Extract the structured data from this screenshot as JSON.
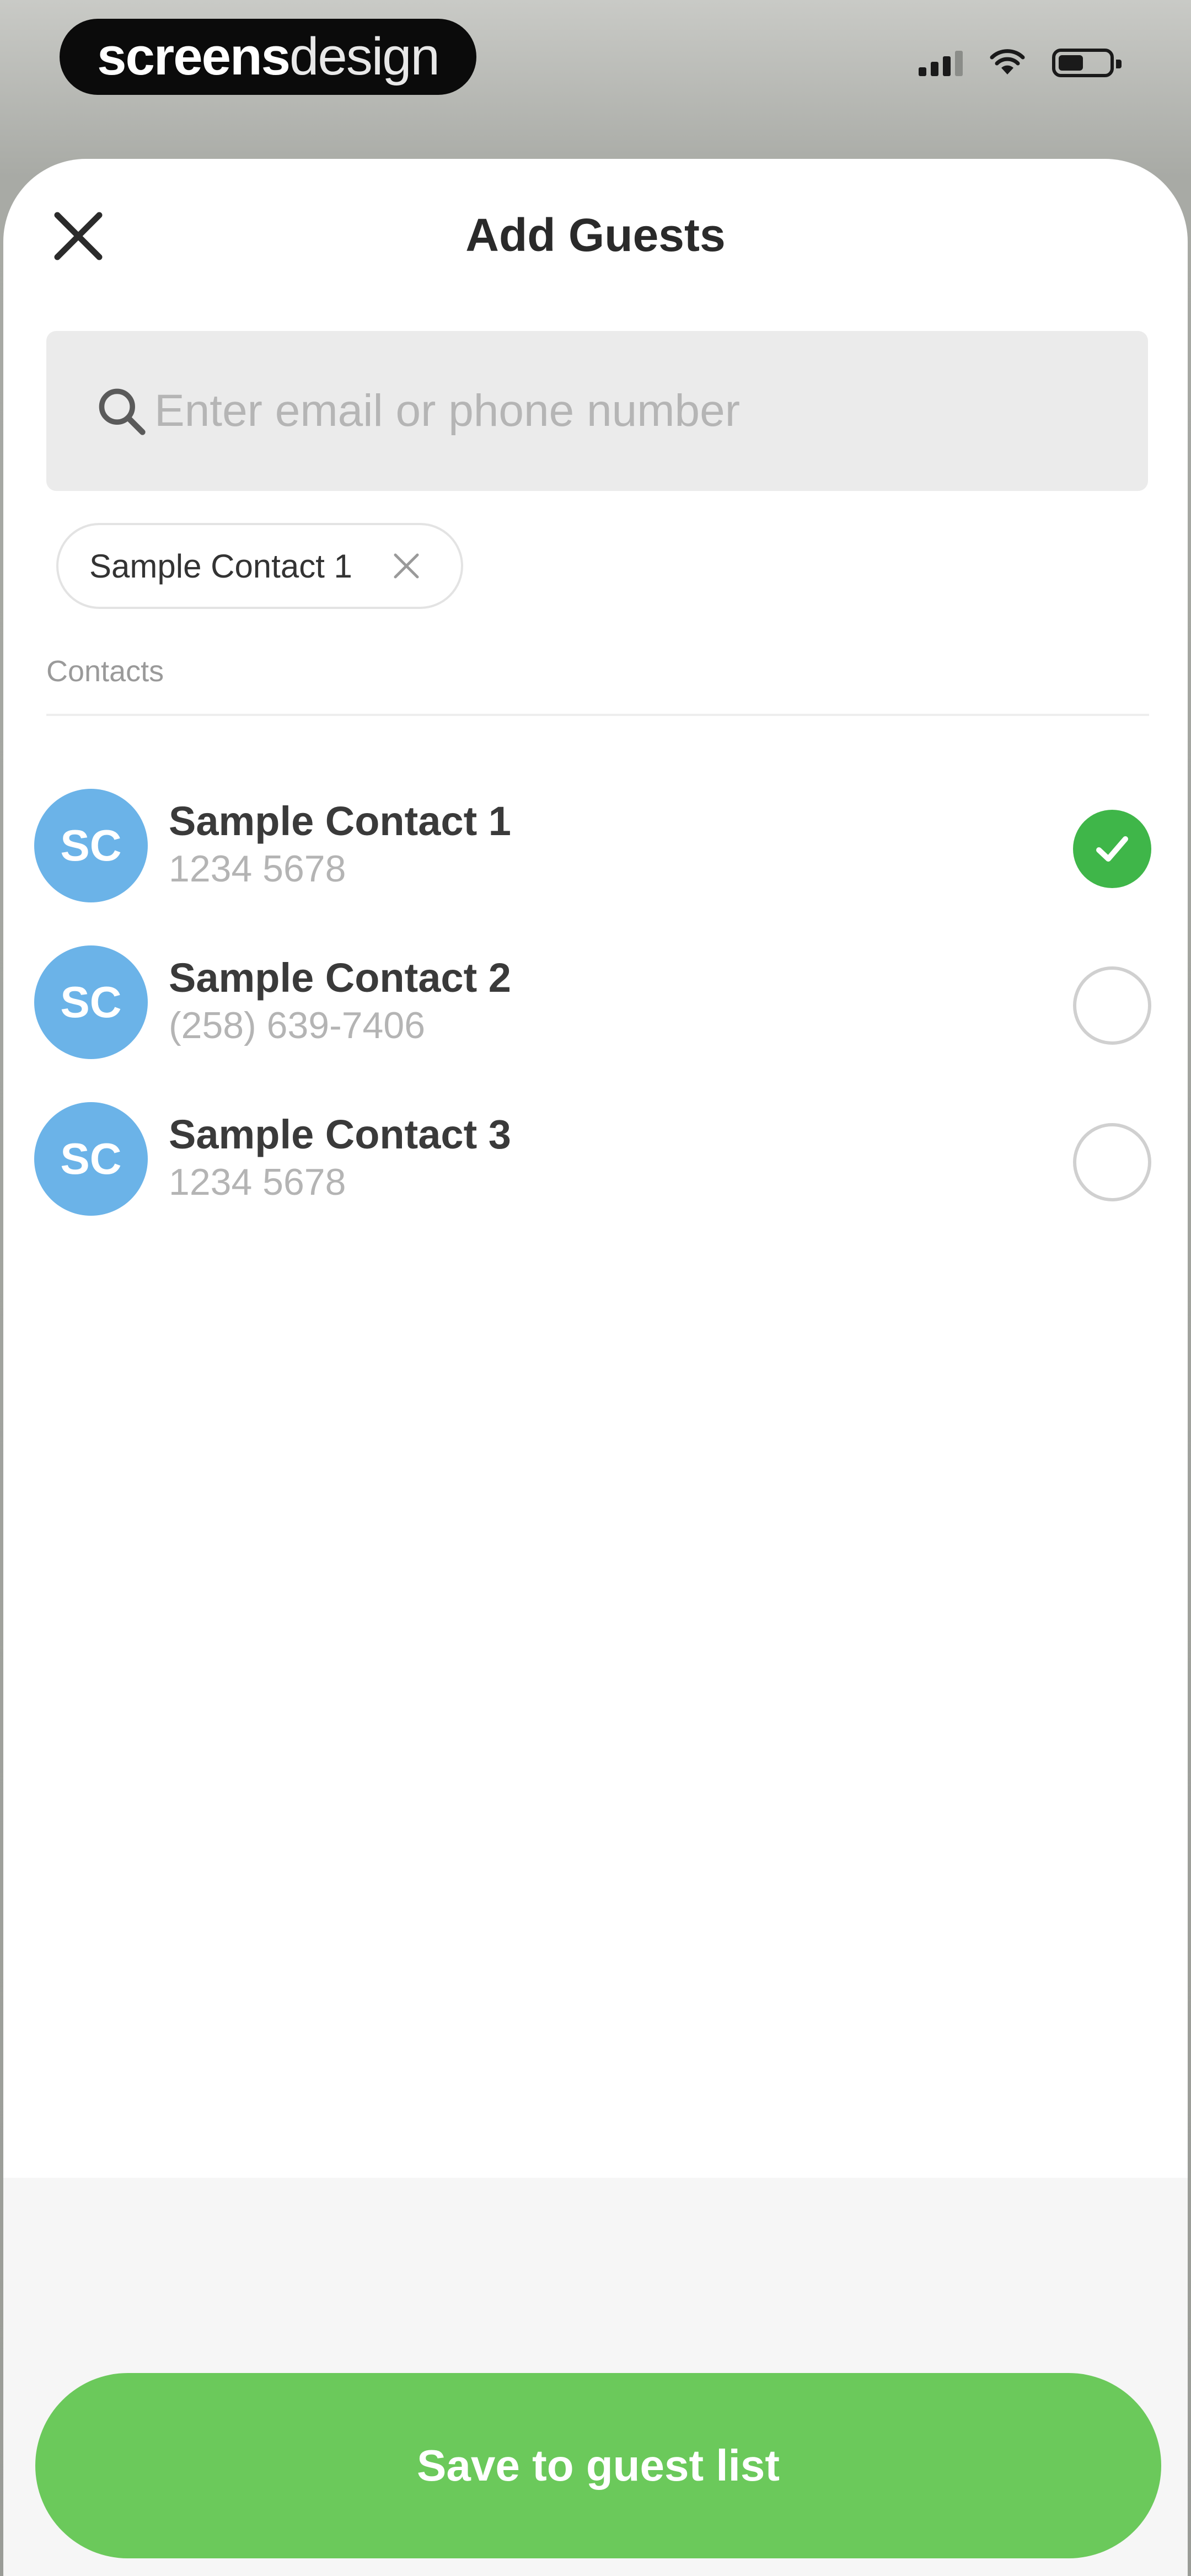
{
  "status_bar": {
    "brand_bold": "screens",
    "brand_light": "design",
    "signal_icon": "cellular-signal-icon",
    "wifi_icon": "wifi-icon",
    "battery_icon": "battery-icon",
    "battery_level": 0.5
  },
  "sheet": {
    "title": "Add Guests",
    "close_icon": "close-icon"
  },
  "search": {
    "placeholder": "Enter email or phone number",
    "value": "",
    "icon": "search-icon"
  },
  "selected_chips": [
    {
      "label": "Sample Contact 1",
      "remove_icon": "close-icon"
    }
  ],
  "contacts_section": {
    "label": "Contacts"
  },
  "contacts": [
    {
      "initials": "SC",
      "name": "Sample Contact 1",
      "phone": "1234 5678",
      "selected": true
    },
    {
      "initials": "SC",
      "name": "Sample Contact 2",
      "phone": "(258) 639-7406",
      "selected": false
    },
    {
      "initials": "SC",
      "name": "Sample Contact 3",
      "phone": "1234 5678",
      "selected": false
    }
  ],
  "footer": {
    "save_label": "Save to guest list"
  },
  "colors": {
    "accent_green": "#6bc95b",
    "check_green": "#3fb649",
    "avatar_blue": "#6bb3e8",
    "search_bg": "#ebebeb"
  }
}
